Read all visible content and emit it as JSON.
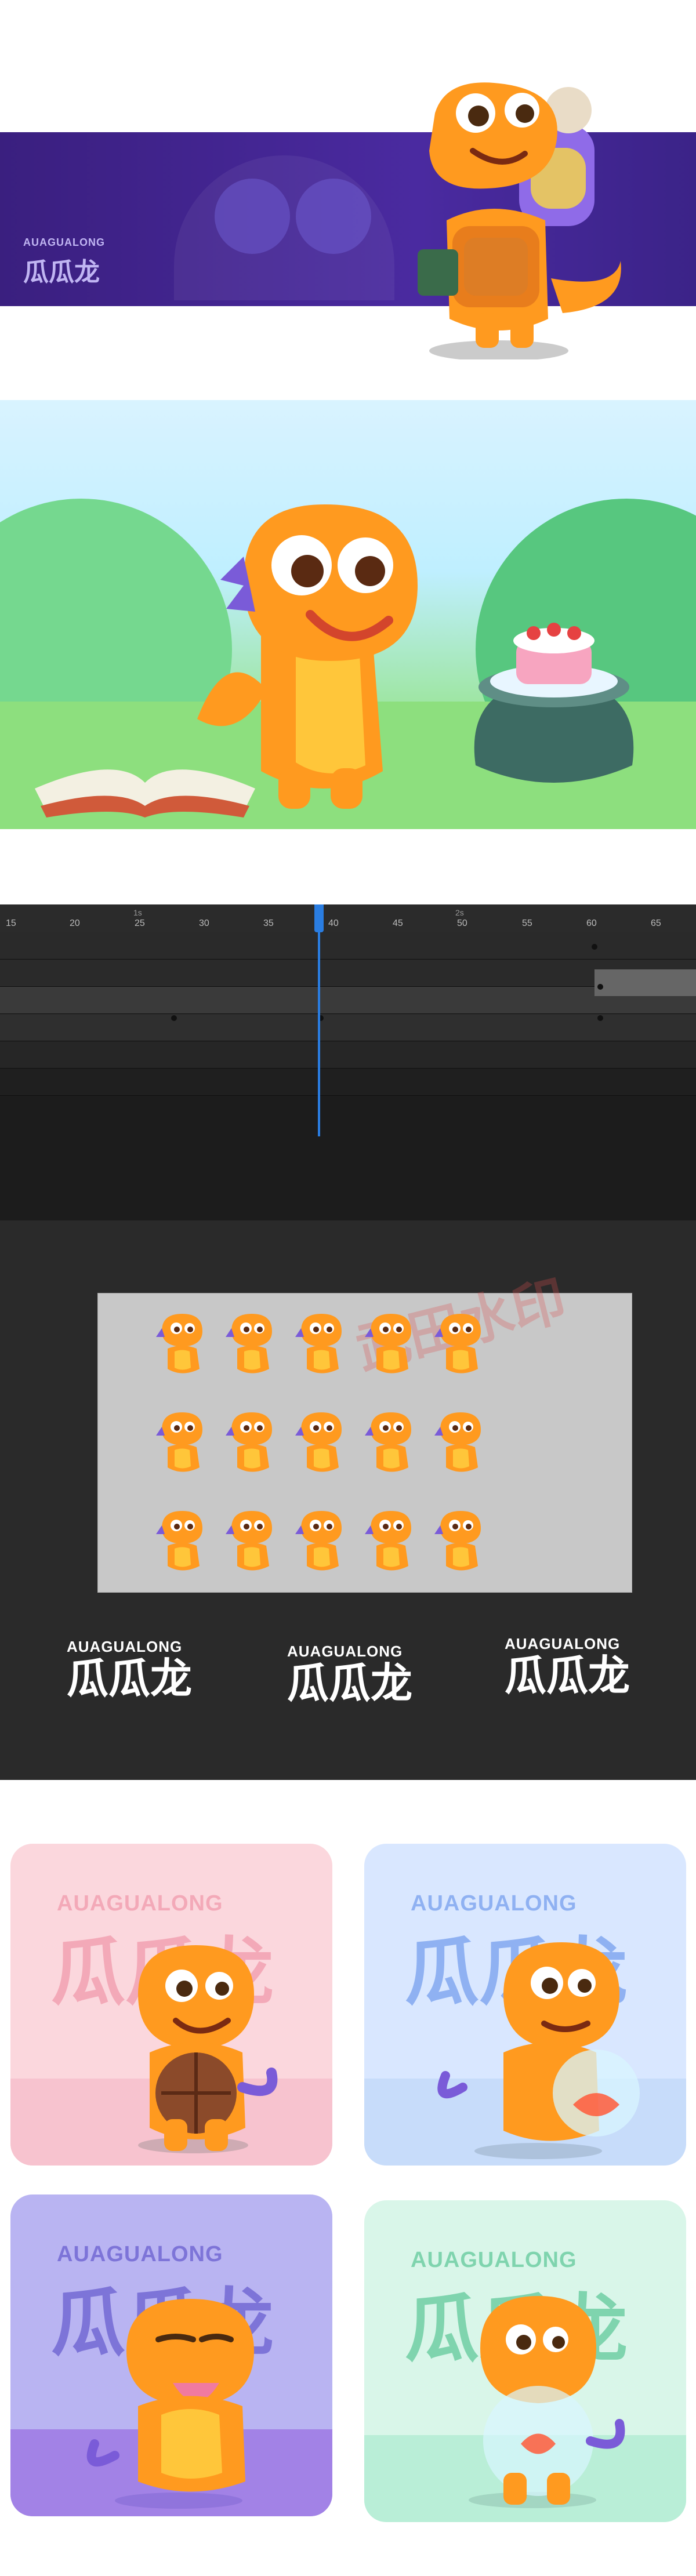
{
  "banner": {
    "brand_small": "AUAGUALONG",
    "brand_big": "瓜瓜龙"
  },
  "timeline": {
    "seconds": [
      "1s",
      "2s"
    ],
    "ticks": [
      "15",
      "20",
      "25",
      "30",
      "35",
      "40",
      "45",
      "50",
      "55",
      "60",
      "65"
    ]
  },
  "sprite_sheet": {
    "watermark": "武田水印"
  },
  "logos": [
    {
      "small": "AUAGUALONG",
      "big": "瓜瓜龙"
    },
    {
      "small": "AUAGUALONG",
      "big": "瓜瓜龙"
    },
    {
      "small": "AUAGUALONG",
      "big": "瓜瓜龙"
    }
  ],
  "cards": [
    {
      "small": "AUAGUALONG",
      "big": "瓜瓜龙",
      "bg": "#fbd7dd",
      "text": "#f3a9b8",
      "floor": "#f7c3cf"
    },
    {
      "small": "AUAGUALONG",
      "big": "瓜瓜龙",
      "bg": "#d9e7ff",
      "text": "#8fb1f2",
      "floor": "#c7dcfa"
    },
    {
      "small": "AUAGUALONG",
      "big": "瓜瓜龙",
      "bg": "#b9b4f2",
      "text": "#7d74d8",
      "floor": "#a282e6"
    },
    {
      "small": "AUAGUALONG",
      "big": "瓜瓜龙",
      "bg": "#d9f6e9",
      "text": "#7fd4ae",
      "floor": "#b9eed7"
    }
  ],
  "colors": {
    "dino_orange": "#ff9a1f",
    "dino_belly": "#ffc63a",
    "dino_spikes": "#7a5bd8",
    "playhead": "#2a7de1"
  }
}
